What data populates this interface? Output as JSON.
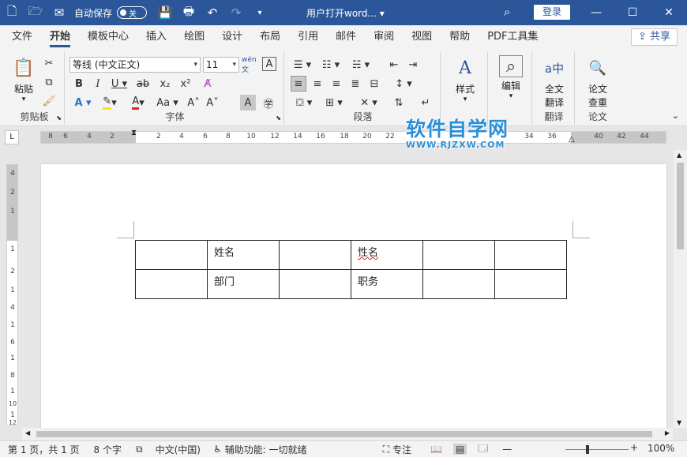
{
  "titlebar": {
    "autosave_label": "自动保存",
    "autosave_state": "关",
    "doc_title": "用户打开word...",
    "login": "登录",
    "icons": [
      "new-file-icon",
      "open-folder-icon",
      "send-icon",
      "save-icon",
      "print-preview-icon",
      "undo-icon",
      "redo-icon",
      "customize-icon"
    ]
  },
  "menu": {
    "tabs": [
      "文件",
      "开始",
      "模板中心",
      "插入",
      "绘图",
      "设计",
      "布局",
      "引用",
      "邮件",
      "审阅",
      "视图",
      "帮助",
      "PDF工具集"
    ],
    "active": "开始",
    "share": "共享"
  },
  "ribbon": {
    "clipboard": {
      "paste": "粘贴",
      "label": "剪贴板"
    },
    "font": {
      "name": "等线 (中文正文)",
      "size": "11",
      "label": "字体"
    },
    "paragraph": {
      "label": "段落"
    },
    "styles": {
      "label": "样式"
    },
    "editing": {
      "label": "编辑"
    },
    "translate": {
      "button": "全文翻译",
      "line1": "全文",
      "line2": "翻译",
      "label": "翻译"
    },
    "paper": {
      "line1": "论文",
      "line2": "查重",
      "label": "论文"
    }
  },
  "ruler": {
    "corner": "L",
    "numbers": [
      "8",
      "6",
      "4",
      "2",
      "2",
      "4",
      "6",
      "8",
      "10",
      "12",
      "14",
      "16",
      "18",
      "20",
      "22",
      "34",
      "36",
      "40",
      "42",
      "44"
    ],
    "vnumbers": [
      "4",
      "2",
      "1",
      "1",
      "2",
      "1",
      "4",
      "1",
      "6",
      "1",
      "8",
      "1",
      "10",
      "1",
      "12"
    ]
  },
  "watermark": {
    "cn": "软件自学网",
    "url": "WWW.RJZXW.COM"
  },
  "table": {
    "rows": [
      [
        "",
        "姓名",
        "",
        "性名",
        "",
        ""
      ],
      [
        "",
        "部门",
        "",
        "职务",
        "",
        ""
      ]
    ]
  },
  "status": {
    "page": "第 1 页，共 1 页",
    "words": "8 个字",
    "language": "中文(中国)",
    "accessibility": "辅助功能: 一切就绪",
    "focus": "专注",
    "zoom": "100%"
  }
}
